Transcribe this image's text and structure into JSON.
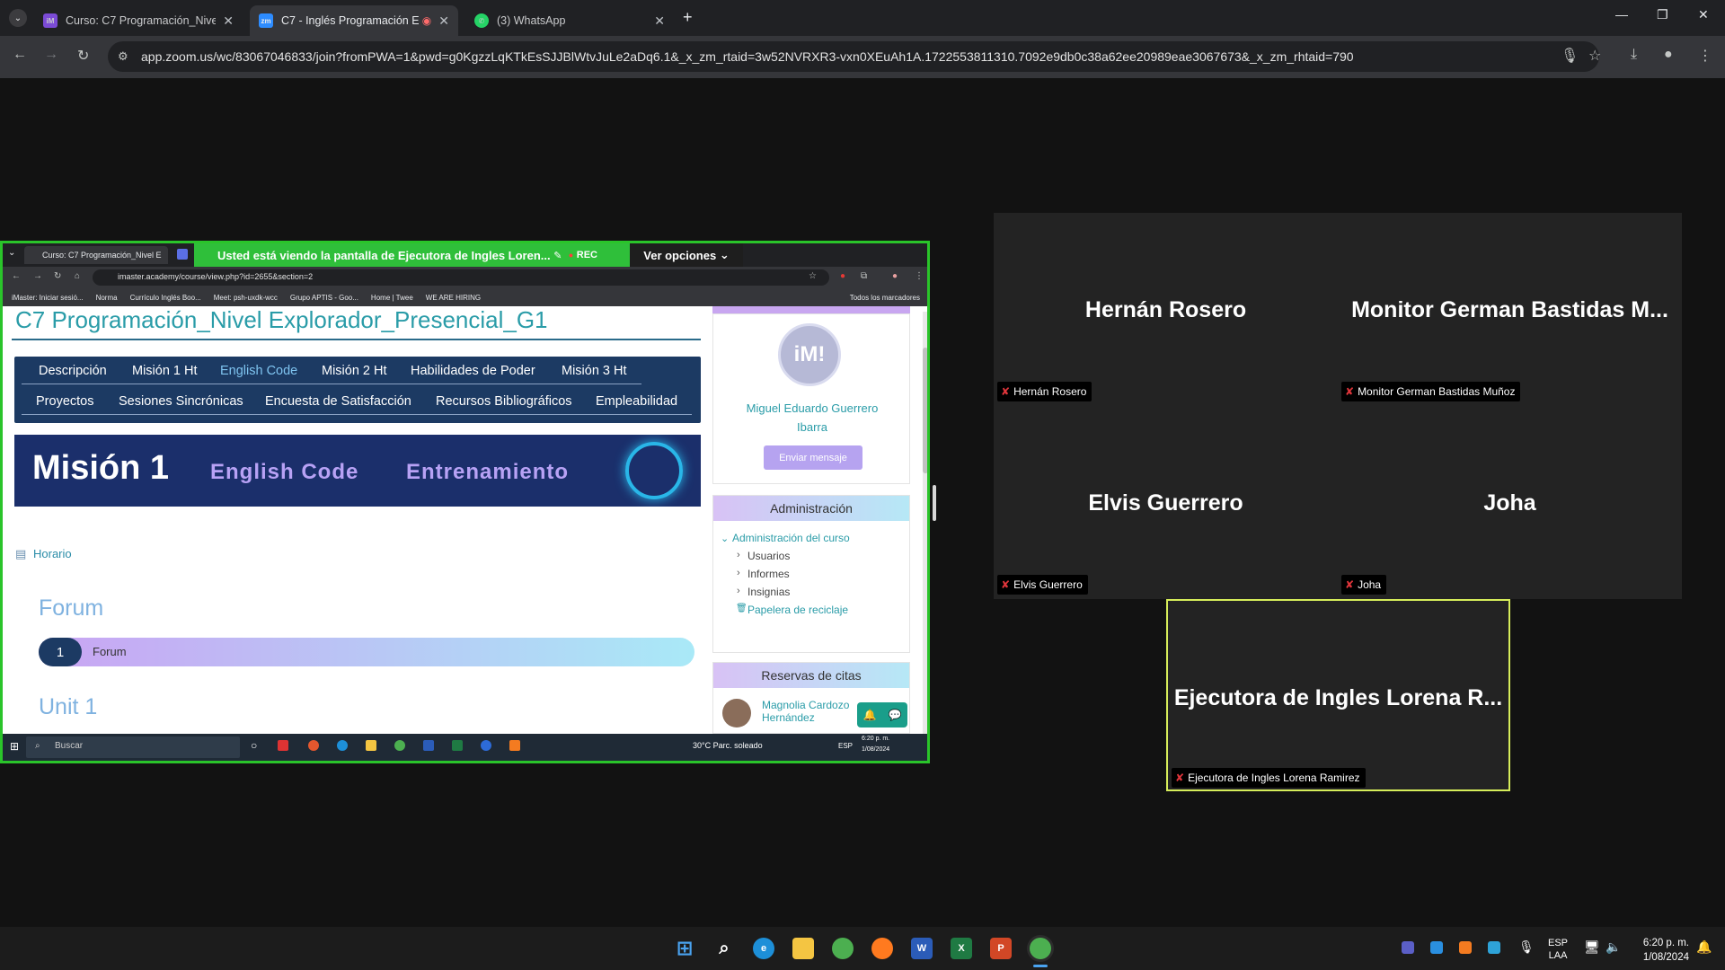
{
  "browser": {
    "tabs": [
      {
        "title": "Curso: C7 Programación_Nivel E",
        "active": false
      },
      {
        "title": "C7 - Inglés Programación E",
        "active": true
      },
      {
        "title": "(3) WhatsApp",
        "active": false
      }
    ],
    "url": "app.zoom.us/wc/83067046833/join?fromPWA=1&pwd=g0KgzzLqKTkEsSJJBlWtvJuLe2aDq6.1&_x_zm_rtaid=3w52NVRXR3-vxn0XEuAh1A.1722553811310.7092e9db0c38a62ee20989eae3067673&_x_zm_rhtaid=790"
  },
  "share": {
    "banner_prefix": "Usted está viendo la pantalla de",
    "presenter": "Ejecutora de Ingles Loren...",
    "rec": "REC",
    "options": "Ver opciones",
    "inner_tab": "Curso: C7 Programación_Nivel E",
    "inner_url": "imaster.academy/course/view.php?id=2655&section=2",
    "bookmarks": [
      "iMaster: Iniciar sesió...",
      "Norma",
      "Currículo Inglés Boo...",
      "Meet: psh-uxdk-wcc",
      "Grupo APTIS - Goo...",
      "Home | Twee",
      "WE ARE HIRING"
    ],
    "bookmarks_right": "Todos los marcadores",
    "course_title": "C7 Programación_Nivel Explorador_Presencial_G1",
    "nav_row1": [
      "Descripción",
      "Misión 1 Ht",
      "English Code",
      "Misión 2 Ht",
      "Habilidades de Poder",
      "Misión 3 Ht"
    ],
    "nav_row2": [
      "Proyectos",
      "Sesiones Sincrónicas",
      "Encuesta de Satisfacción",
      "Recursos Bibliográficos",
      "Empleabilidad"
    ],
    "banner_text": {
      "mision": "Misión 1",
      "english": "English Code",
      "entrenamiento": "Entrenamiento"
    },
    "horario": "Horario",
    "forum_heading": "Forum",
    "forum_item": {
      "number": "1",
      "label": "Forum"
    },
    "unit_heading": "Unit 1",
    "teacher": {
      "avatar": "iM!",
      "name": "Miguel Eduardo Guerrero Ibarra",
      "button": "Enviar mensaje"
    },
    "admin": {
      "title": "Administración",
      "course_admin": "Administración del curso",
      "items": [
        "Usuarios",
        "Informes",
        "Insignias"
      ],
      "trash": "Papelera de reciclaje"
    },
    "reservas": {
      "title": "Reservas de citas",
      "person": "Magnolia Cardozo Hernández"
    },
    "taskbar": {
      "search": "Buscar",
      "weather": "30°C Parc. soleado",
      "lang": "ESP",
      "time": "6:20 p. m.",
      "date": "1/08/2024"
    }
  },
  "participants": [
    {
      "display": "Hernán Rosero",
      "label": "Hernán Rosero"
    },
    {
      "display": "Monitor German Bastidas M...",
      "label": "Monitor German Bastidas Muñoz"
    },
    {
      "display": "Elvis Guerrero",
      "label": "Elvis Guerrero"
    },
    {
      "display": "Joha",
      "label": "Joha"
    }
  ],
  "active_speaker": {
    "display": "Ejecutora de Ingles Lorena R...",
    "label": "Ejecutora de Ingles Lorena Ramirez"
  },
  "taskbar": {
    "lang_line1": "ESP",
    "lang_line2": "LAA",
    "time": "6:20 p. m.",
    "date": "1/08/2024"
  }
}
